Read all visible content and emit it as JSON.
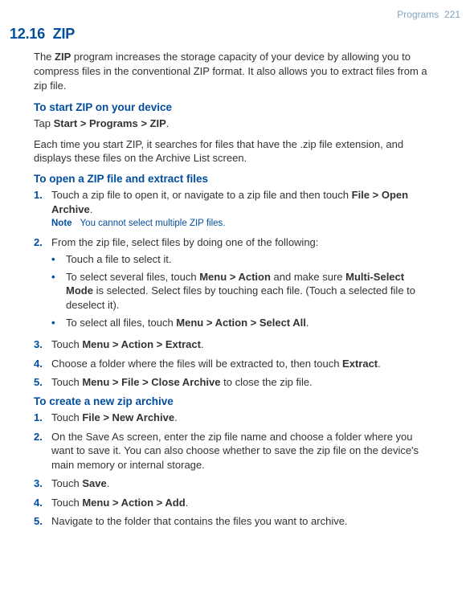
{
  "header": {
    "chapter": "Programs",
    "page": "221"
  },
  "section": {
    "number": "12.16",
    "title": "ZIP"
  },
  "intro": "The <strong>ZIP</strong> program increases the storage capacity of your device by allowing you to compress files in the conventional ZIP format. It also allows you to extract files from a zip file.",
  "start": {
    "heading": "To start ZIP on your device",
    "tap_line": "Tap <strong>Start > Programs > ZIP</strong>.",
    "desc": "Each time you start ZIP, it searches for files that have the .zip file extension, and displays these files on the Archive List screen."
  },
  "open": {
    "heading": "To open a ZIP file and extract files",
    "steps": [
      {
        "num": "1.",
        "text": "Touch a zip file to open it, or navigate to a zip file and then touch <strong>File > Open Archive</strong>.",
        "note_label": "Note",
        "note_text": "You cannot select multiple ZIP files."
      },
      {
        "num": "2.",
        "text": "From the zip file, select files by doing one of the following:",
        "bullets": [
          "Touch a file to select it.",
          "To select several files, touch <strong>Menu > Action</strong> and make sure <strong>Multi-Select Mode</strong> is selected. Select files by touching each file. (Touch a selected file to deselect it).",
          "To select all files, touch <strong>Menu > Action > Select All</strong>."
        ]
      },
      {
        "num": "3.",
        "text": "Touch <strong>Menu > Action > Extract</strong>."
      },
      {
        "num": "4.",
        "text": "Choose a folder where the files will be extracted to, then touch <strong>Extract</strong>."
      },
      {
        "num": "5.",
        "text": "Touch <strong>Menu > File > Close Archive</strong> to close the zip file."
      }
    ]
  },
  "create": {
    "heading": "To create a new zip archive",
    "steps": [
      {
        "num": "1.",
        "text": "Touch <strong>File > New Archive</strong>."
      },
      {
        "num": "2.",
        "text": "On the Save As screen, enter the zip file name and choose a folder where you want to save it. You can also choose whether to save the zip file on the device's main memory or internal storage."
      },
      {
        "num": "3.",
        "text": "Touch <strong>Save</strong>."
      },
      {
        "num": "4.",
        "text": "Touch <strong>Menu > Action > Add</strong>."
      },
      {
        "num": "5.",
        "text": "Navigate to the folder that contains the files you want to archive."
      }
    ]
  }
}
